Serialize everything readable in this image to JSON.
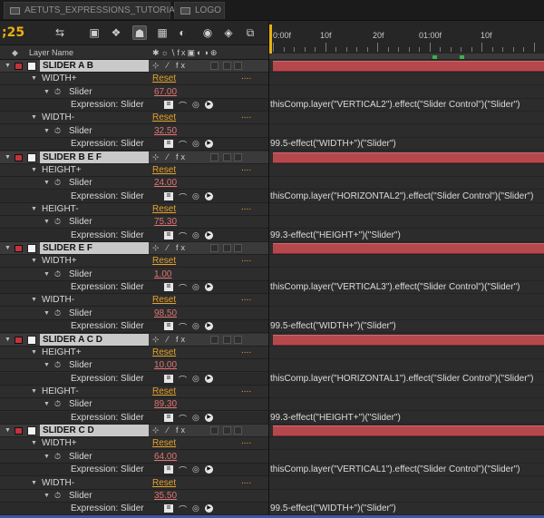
{
  "tabs": [
    "AETUTS_EXPRESSIONS_TUTORIAL",
    "LOGO"
  ],
  "timecode": ";25",
  "column_header": {
    "layer_name": "Layer Name"
  },
  "ruler": {
    "labels": [
      "0:00f",
      "10f",
      "20f",
      "01:00f",
      "10f"
    ]
  },
  "labels": {
    "reset": "Reset",
    "slider": "Slider",
    "expression": "Expression: Slider",
    "dots": "...."
  },
  "layers": [
    {
      "name": "SLIDER A B",
      "groups": [
        {
          "name": "WIDTH+",
          "value": "67.00",
          "expression": "thisComp.layer(\"VERTICAL2\").effect(\"Slider Control\")(\"Slider\")"
        },
        {
          "name": "WIDTH-",
          "value": "32.50",
          "expression": "99.5-effect(\"WIDTH+\")(\"Slider\")"
        }
      ]
    },
    {
      "name": "SLIDER B E F",
      "groups": [
        {
          "name": "HEIGHT+",
          "value": "24.00",
          "expression": "thisComp.layer(\"HORIZONTAL2\").effect(\"Slider Control\")(\"Slider\")"
        },
        {
          "name": "HEIGHT-",
          "value": "75.30",
          "expression": "99.3-effect(\"HEIGHT+\")(\"Slider\")"
        }
      ]
    },
    {
      "name": "SLIDER E F",
      "groups": [
        {
          "name": "WIDTH+",
          "value": "1.00",
          "expression": "thisComp.layer(\"VERTICAL3\").effect(\"Slider Control\")(\"Slider\")"
        },
        {
          "name": "WIDTH-",
          "value": "98.50",
          "expression": "99.5-effect(\"WIDTH+\")(\"Slider\")"
        }
      ]
    },
    {
      "name": "SLIDER A C D",
      "groups": [
        {
          "name": "HEIGHT+",
          "value": "10.00",
          "expression": "thisComp.layer(\"HORIZONTAL1\").effect(\"Slider Control\")(\"Slider\")"
        },
        {
          "name": "HEIGHT-",
          "value": "89.30",
          "expression": "99.3-effect(\"HEIGHT+\")(\"Slider\")"
        }
      ]
    },
    {
      "name": "SLIDER C D",
      "groups": [
        {
          "name": "WIDTH+",
          "value": "64.00",
          "expression": "thisComp.layer(\"VERTICAL1\").effect(\"Slider Control\")(\"Slider\")"
        },
        {
          "name": "WIDTH-",
          "value": "35.50",
          "expression": "99.5-effect(\"WIDTH+\")(\"Slider\")"
        }
      ]
    }
  ],
  "colors": {
    "layer_label": "#c4333c",
    "layer_bar": "#b5484d",
    "timecode": "#e9b10f",
    "reset": "#e6a22a",
    "value": "#e27474",
    "marker": "#3cb34a"
  }
}
